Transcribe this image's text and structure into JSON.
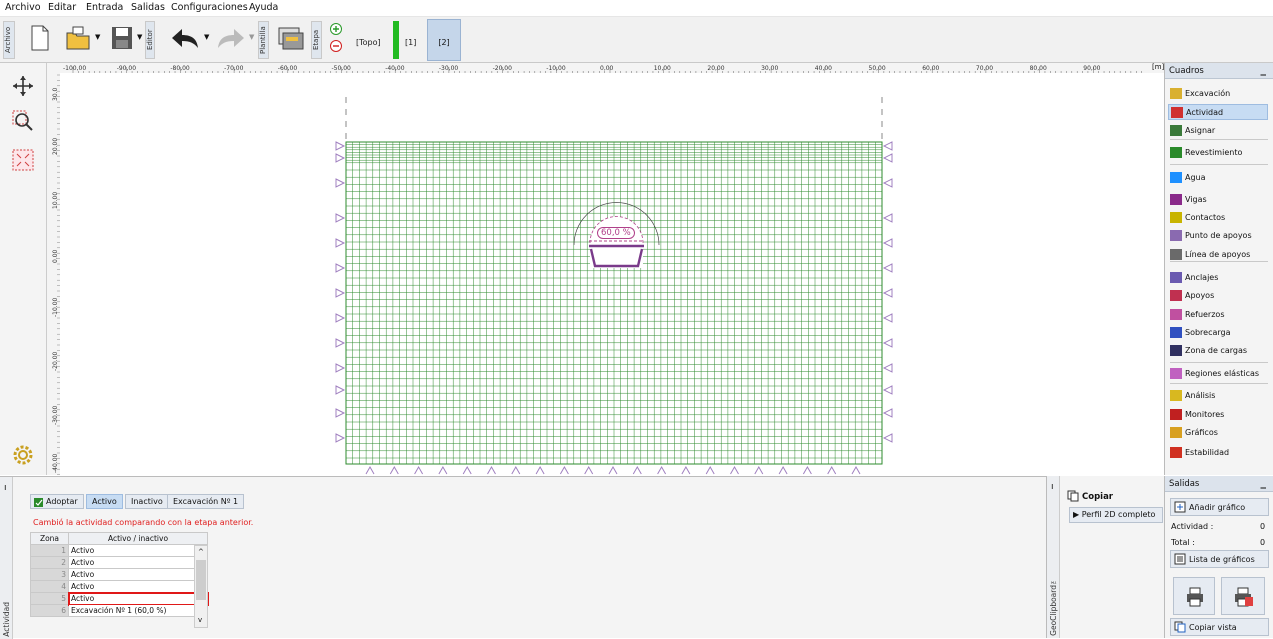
{
  "menu": [
    "Archivo",
    "Editar",
    "Entrada",
    "Salidas",
    "Configuraciones",
    "Ayuda"
  ],
  "toolbar": {
    "archivo_label": "Archivo",
    "editor_label": "Editor",
    "plantilla_label": "Plantilla",
    "etapa_label": "Etapa",
    "stages": [
      "[Topo]",
      "[1]",
      "[2]"
    ],
    "active_stage_color": "#22bb22"
  },
  "ruler": {
    "unit": "[m]",
    "x_ticks": [
      "-100,00",
      "-90,00",
      "-80,00",
      "-70,00",
      "-60,00",
      "-50,00",
      "-40,00",
      "-30,00",
      "-20,00",
      "-10,00",
      "0,00",
      "10,00",
      "20,00",
      "30,00",
      "40,00",
      "50,00",
      "60,00",
      "70,00",
      "80,00",
      "90,00"
    ],
    "y_ticks": [
      "30.0",
      "20.00",
      "10.00",
      "0.00",
      "-10.00",
      "-20.00",
      "-30.00",
      "-40.00"
    ]
  },
  "canvas": {
    "excavation_label": "60,0 %",
    "mesh_color": "#2e8b2e",
    "support_color": "#a080c0"
  },
  "cuadros": {
    "title": "Cuadros",
    "minimize": "_",
    "items": [
      {
        "label": "Excavación",
        "icon": "excavation-icon",
        "color": "#d9b030"
      },
      {
        "label": "Actividad",
        "icon": "activity-icon",
        "color": "#d03030",
        "selected": true
      },
      {
        "label": "Asignar",
        "icon": "assign-icon",
        "color": "#3a7a3a"
      },
      {
        "label": "Revestimiento",
        "icon": "lining-icon",
        "color": "#2a8a2a"
      },
      {
        "label": "Agua",
        "icon": "water-icon",
        "color": "#1e90ff"
      },
      {
        "label": "Vigas",
        "icon": "beams-icon",
        "color": "#8a2a8a"
      },
      {
        "label": "Contactos",
        "icon": "contacts-icon",
        "color": "#c8b400"
      },
      {
        "label": "Punto de apoyos",
        "icon": "point-support-icon",
        "color": "#8a6ab0"
      },
      {
        "label": "Línea de apoyos",
        "icon": "line-support-icon",
        "color": "#6a6a6a"
      },
      {
        "label": "Anclajes",
        "icon": "anchors-icon",
        "color": "#6a5ab0"
      },
      {
        "label": "Apoyos",
        "icon": "supports-icon",
        "color": "#c03050"
      },
      {
        "label": "Refuerzos",
        "icon": "reinforcement-icon",
        "color": "#c050a0"
      },
      {
        "label": "Sobrecarga",
        "icon": "surcharge-icon",
        "color": "#3050c0"
      },
      {
        "label": "Zona de cargas",
        "icon": "load-zone-icon",
        "color": "#303060"
      },
      {
        "label": "Regiones elásticas",
        "icon": "elastic-regions-icon",
        "color": "#c060c0"
      },
      {
        "label": "Análisis",
        "icon": "analysis-icon",
        "color": "#d8b820"
      },
      {
        "label": "Monitores",
        "icon": "monitors-icon",
        "color": "#c02020"
      },
      {
        "label": "Gráficos",
        "icon": "graphs-icon",
        "color": "#d8a020"
      },
      {
        "label": "Estabilidad",
        "icon": "stability-icon",
        "color": "#d03020"
      }
    ]
  },
  "bottom": {
    "panel_label": "Actividad",
    "adopt": "Adoptar",
    "active": "Activo",
    "inactive": "Inactivo",
    "excav": "Excavación Nº 1",
    "message": "Cambió la actividad comparando con la etapa anterior.",
    "col_zone": "Zona",
    "col_active": "Activo / inactivo",
    "rows": [
      {
        "n": "1",
        "v": "Activo"
      },
      {
        "n": "2",
        "v": "Activo"
      },
      {
        "n": "3",
        "v": "Activo"
      },
      {
        "n": "4",
        "v": "Activo"
      },
      {
        "n": "5",
        "v": "Activo"
      },
      {
        "n": "6",
        "v": "Excavación Nº 1 (60,0 %)"
      }
    ]
  },
  "clipboard": {
    "label": "GeoClipboard™",
    "copy": "Copiar",
    "perfil": "Perfil 2D completo"
  },
  "salidas": {
    "title": "Salidas",
    "minimize": "_",
    "add_graph": "Añadir gráfico",
    "actividad_label": "Actividad :",
    "actividad_val": "0",
    "total_label": "Total :",
    "total_val": "0",
    "list_graphs": "Lista de gráficos",
    "copy_view": "Copiar vista"
  }
}
